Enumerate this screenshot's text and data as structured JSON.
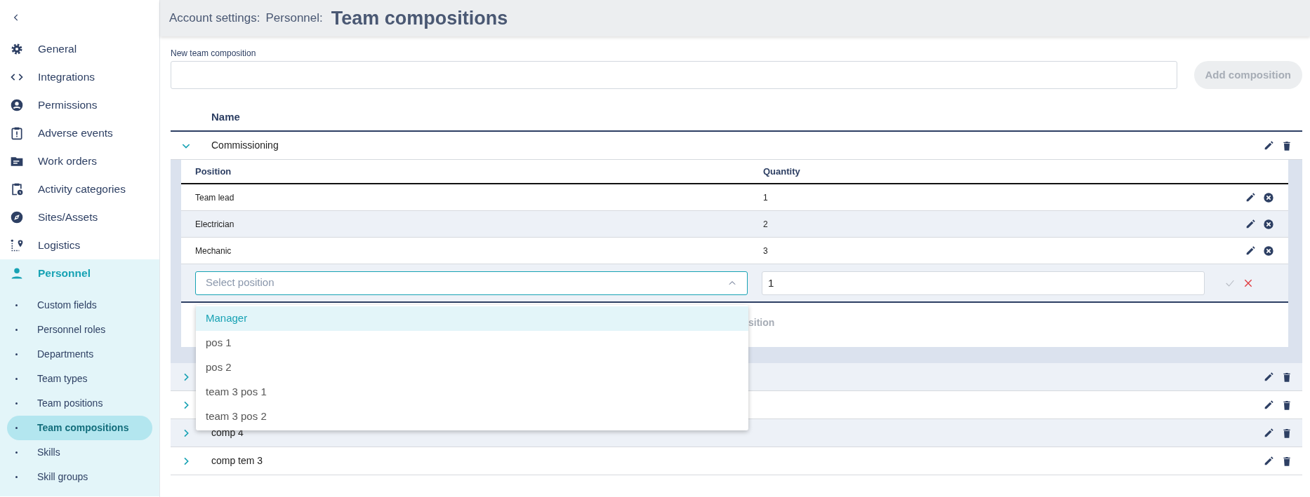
{
  "sidebar": {
    "items": [
      {
        "label": "General",
        "selected": false
      },
      {
        "label": "Integrations",
        "selected": false
      },
      {
        "label": "Permissions",
        "selected": false
      },
      {
        "label": "Adverse events",
        "selected": false
      },
      {
        "label": "Work orders",
        "selected": false
      },
      {
        "label": "Activity categories",
        "selected": false
      },
      {
        "label": "Sites/Assets",
        "selected": false
      },
      {
        "label": "Logistics",
        "selected": false
      },
      {
        "label": "Personnel",
        "selected": true,
        "expanded": true,
        "children": [
          {
            "label": "Custom fields",
            "selected": false
          },
          {
            "label": "Personnel roles",
            "selected": false
          },
          {
            "label": "Departments",
            "selected": false
          },
          {
            "label": "Team types",
            "selected": false
          },
          {
            "label": "Team positions",
            "selected": false
          },
          {
            "label": "Team compositions",
            "selected": true
          },
          {
            "label": "Skills",
            "selected": false
          },
          {
            "label": "Skill groups",
            "selected": false
          }
        ]
      }
    ]
  },
  "header": {
    "breadcrumbs": [
      "Account settings:",
      "Personnel:"
    ],
    "title": "Team compositions"
  },
  "new_composition": {
    "label": "New team composition",
    "button": "Add composition",
    "button_disabled": true
  },
  "table": {
    "columns": [
      "Name"
    ],
    "rows": [
      {
        "name": "Commissioning",
        "expanded": true,
        "positions": {
          "columns": [
            "Position",
            "Quantity"
          ],
          "rows": [
            {
              "position": "Team lead",
              "quantity": "1"
            },
            {
              "position": "Electrician",
              "quantity": "2"
            },
            {
              "position": "Mechanic",
              "quantity": "3"
            }
          ],
          "new_row": {
            "placeholder": "Select position",
            "quantity": "1",
            "confirm_disabled": true,
            "dropdown_open": true,
            "options": [
              {
                "label": "Manager",
                "selected": true
              },
              {
                "label": "pos 1",
                "selected": false
              },
              {
                "label": "pos 2",
                "selected": false
              },
              {
                "label": "team 3 pos 1",
                "selected": false
              },
              {
                "label": "team 3 pos 2",
                "selected": false
              }
            ]
          },
          "add_button": "sition"
        }
      },
      {
        "expanded": false
      },
      {
        "expanded": false
      },
      {
        "name": "comp 4",
        "expanded": false
      },
      {
        "name": "comp tem 3",
        "expanded": false
      }
    ]
  }
}
